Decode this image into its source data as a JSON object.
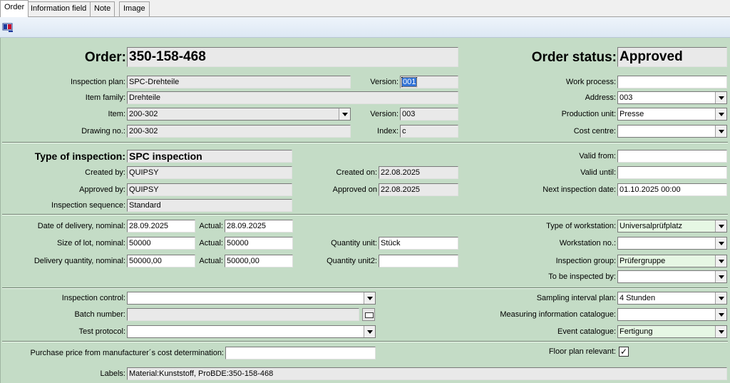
{
  "tabs": [
    "Order",
    "Information field",
    "Note",
    "Image"
  ],
  "toolbar": {
    "icon": "settings-icon"
  },
  "header": {
    "order_label": "Order:",
    "order_value": "350-158-468",
    "status_label": "Order status:",
    "status_value": "Approved"
  },
  "plan": {
    "inspection_plan_label": "Inspection plan:",
    "inspection_plan": "SPC-Drehteile",
    "version_label": "Version:",
    "version": "001",
    "item_family_label": "Item family:",
    "item_family": "Drehteile",
    "item_label": "Item:",
    "item": "200-302",
    "item_version_label": "Version:",
    "item_version": "003",
    "drawing_label": "Drawing no.:",
    "drawing": "200-302",
    "index_label": "Index:",
    "index": "c",
    "work_process_label": "Work process:",
    "work_process": "",
    "address_label": "Address:",
    "address": "003",
    "production_unit_label": "Production unit:",
    "production_unit": "Presse",
    "cost_centre_label": "Cost centre:",
    "cost_centre": ""
  },
  "inspection": {
    "type_label": "Type of inspection:",
    "type": "SPC inspection",
    "created_by_label": "Created by:",
    "created_by": "QUIPSY",
    "created_on_label": "Created on:",
    "created_on": "22.08.2025",
    "approved_by_label": "Approved by:",
    "approved_by": "QUIPSY",
    "approved_on_label": "Approved on",
    "approved_on": "22.08.2025",
    "sequence_label": "Inspection sequence:",
    "sequence": "Standard",
    "valid_from_label": "Valid from:",
    "valid_from": "",
    "valid_until_label": "Valid until:",
    "valid_until": "",
    "next_date_label": "Next inspection date:",
    "next_date": "01.10.2025  00:00"
  },
  "delivery": {
    "date_nominal_label": "Date of delivery, nominal:",
    "date_nominal": "28.09.2025",
    "date_actual_label": "Actual:",
    "date_actual": "28.09.2025",
    "lot_nominal_label": "Size of lot, nominal:",
    "lot_nominal": "50000",
    "lot_actual_label": "Actual:",
    "lot_actual": "50000",
    "qty_unit_label": "Quantity unit:",
    "qty_unit": "Stück",
    "qty_nominal_label": "Delivery quantity, nominal:",
    "qty_nominal": "50000,00",
    "qty_actual_label": "Actual:",
    "qty_actual": "50000,00",
    "qty_unit2_label": "Quantity unit2:",
    "qty_unit2": "",
    "workstation_type_label": "Type of workstation:",
    "workstation_type": "Universalprüfplatz",
    "workstation_no_label": "Workstation no.:",
    "workstation_no": "",
    "inspection_group_label": "Inspection group:",
    "inspection_group": "Prüfergruppe",
    "to_be_inspected_label": "To be inspected by:",
    "to_be_inspected": ""
  },
  "control": {
    "inspection_control_label": "Inspection control:",
    "inspection_control": "",
    "batch_label": "Batch number:",
    "batch": "",
    "test_protocol_label": "Test protocol:",
    "test_protocol": "",
    "sampling_label": "Sampling interval plan:",
    "sampling": "4 Stunden",
    "measuring_label": "Measuring information catalogue:",
    "measuring": "",
    "event_label": "Event catalogue:",
    "event": "Fertigung"
  },
  "footer": {
    "purchase_label": "Purchase price from manufacturer´s cost determination:",
    "purchase": "",
    "floor_label": "Floor plan relevant:",
    "floor_check": "✓",
    "labels_label": "Labels:",
    "labels": "Material:Kunststoff, ProBDE:350-158-468"
  }
}
